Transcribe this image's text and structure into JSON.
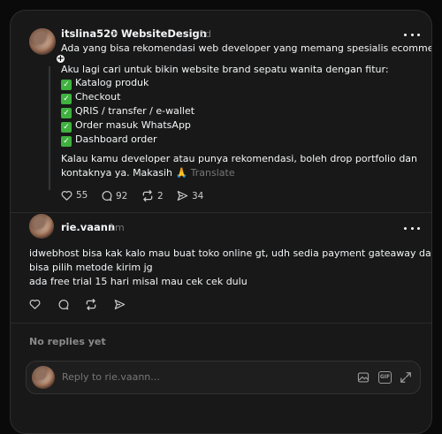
{
  "post": {
    "username": "itslina520",
    "separator": ">",
    "community": "WebsiteDesign",
    "time": "1d",
    "headline": "Ada yang bisa rekomendasi web developer yang memang spesialis ecommerce?",
    "intro": "Aku lagi cari untuk bikin website brand sepatu wanita dengan fitur:",
    "features": [
      "Katalog produk",
      "Checkout",
      "QRIS / transfer / e-wallet",
      "Order masuk WhatsApp",
      "Dashboard order"
    ],
    "outro_line1": "Kalau kamu developer atau punya rekomendasi, boleh drop portfolio dan",
    "outro_line2": "kontaknya ya. Makasih 🙏",
    "translate": "Translate",
    "likes": "55",
    "comments": "92",
    "reposts": "2",
    "shares": "34"
  },
  "reply": {
    "username": "rie.vaann",
    "time": "1m",
    "line1": "idwebhost bisa kak kalo mau buat toko online gt, udh sedia payment gateaway dan",
    "line2": "bisa pilih metode kirim jg",
    "line3": "ada free trial 15 hari misal mau cek cek dulu"
  },
  "no_replies": "No replies yet",
  "composer": {
    "placeholder": "Reply to rie.vaann...",
    "gif_label": "GIF"
  },
  "icons": [
    "more-icon",
    "heart-icon",
    "comment-icon",
    "repost-icon",
    "share-icon",
    "image-icon",
    "gif-icon",
    "expand-icon",
    "plus-icon",
    "check-icon"
  ],
  "colors": {
    "background": "#0a0a0a",
    "card": "#181818",
    "muted": "#777777",
    "check_green": "#3fb13f"
  }
}
